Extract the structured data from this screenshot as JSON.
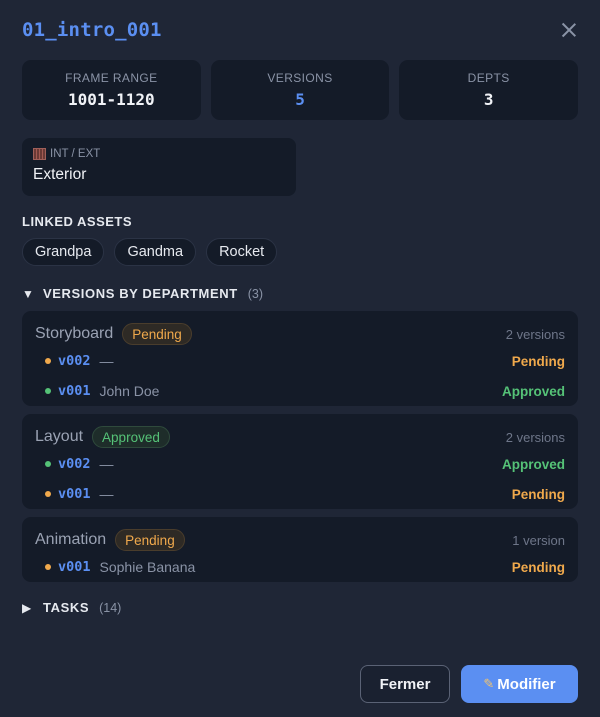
{
  "header": {
    "title": "01_intro_001"
  },
  "stats": [
    {
      "label": "FRAME RANGE",
      "value": "1001-1120"
    },
    {
      "label": "VERSIONS",
      "value": "5"
    },
    {
      "label": "DEPTS",
      "value": "3"
    }
  ],
  "int_ext": {
    "icon": "film-icon",
    "label": "INT / EXT",
    "value": "Exterior"
  },
  "linked_assets": {
    "title": "LINKED ASSETS",
    "items": [
      "Grandpa",
      "Gandma",
      "Rocket"
    ]
  },
  "versions_by_department": {
    "title": "VERSIONS BY DEPARTMENT",
    "count": "(3)",
    "departments": [
      {
        "name": "Storyboard",
        "badge": "Pending",
        "count_text": "2 versions",
        "versions": [
          {
            "code": "v002",
            "user": "—",
            "status": "Pending"
          },
          {
            "code": "v001",
            "user": "John Doe",
            "status": "Approved"
          }
        ]
      },
      {
        "name": "Layout",
        "badge": "Approved",
        "count_text": "2 versions",
        "versions": [
          {
            "code": "v002",
            "user": "—",
            "status": "Approved"
          },
          {
            "code": "v001",
            "user": "—",
            "status": "Pending"
          }
        ]
      },
      {
        "name": "Animation",
        "badge": "Pending",
        "count_text": "1 version",
        "versions": [
          {
            "code": "v001",
            "user": "Sophie Banana",
            "status": "Pending"
          }
        ]
      }
    ]
  },
  "tasks": {
    "title": "TASKS",
    "count": "(14)"
  },
  "footer": {
    "close_label": "Fermer",
    "edit_label": "Modifier",
    "edit_icon": "pencil-icon"
  },
  "colors": {
    "accent": "#5b8ff2",
    "pending": "#f0a94c",
    "approved": "#55c277",
    "panel": "#1f2636",
    "card": "#141b28"
  }
}
